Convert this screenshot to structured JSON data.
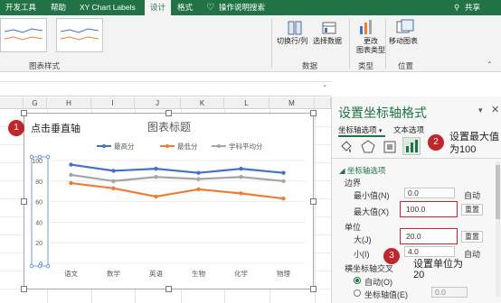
{
  "ribbon": {
    "tabs": [
      "开发工具",
      "帮助",
      "XY Chart Labels",
      "设计",
      "格式"
    ],
    "tell_me": "操作说明搜索",
    "share": "共享",
    "groups": {
      "chart_styles": "图表样式",
      "data": "数据",
      "type": "类型",
      "location": "位置"
    },
    "buttons": {
      "switch_row_col": "切换行/列",
      "select_data": "选择数据",
      "change_type": "更改\n图表类型",
      "move_chart": "移动图表"
    }
  },
  "columns": [
    "G",
    "H",
    "I",
    "J",
    "K",
    "L",
    "M"
  ],
  "chart": {
    "title": "图表标题",
    "legend": [
      "最高分",
      "最低分",
      "学科平均分"
    ],
    "categories": [
      "语文",
      "数学",
      "英语",
      "生物",
      "化学",
      "物理"
    ],
    "y_ticks": [
      "100",
      "80",
      "60",
      "40",
      "20",
      "0"
    ]
  },
  "chart_data": {
    "type": "line",
    "title": "图表标题",
    "categories": [
      "语文",
      "数学",
      "英语",
      "生物",
      "化学",
      "物理"
    ],
    "ylim": [
      0,
      100
    ],
    "y_major_unit": 20,
    "legend_position": "top",
    "series": [
      {
        "name": "最高分",
        "color": "#4472C4",
        "values": [
          96,
          90,
          92,
          88,
          92,
          88
        ]
      },
      {
        "name": "最低分",
        "color": "#ED7D31",
        "values": [
          78,
          73,
          65,
          72,
          68,
          63
        ]
      },
      {
        "name": "学科平均分",
        "color": "#A5A5A5",
        "values": [
          86,
          80,
          84,
          82,
          84,
          80
        ]
      }
    ]
  },
  "pane": {
    "title": "设置坐标轴格式",
    "tab_axis": "坐标轴选项",
    "tab_text": "文本选项",
    "section": "坐标轴选项",
    "bounds": "边界",
    "min_label": "最小值(N)",
    "min_value": "0.0",
    "max_label": "最大值(X)",
    "max_value": "100.0",
    "auto": "自动",
    "reset": "重置",
    "units": "单位",
    "major_label": "大(J)",
    "major_value": "20.0",
    "minor_label": "小(I)",
    "minor_value": "4.0",
    "cross_label": "横坐标轴交叉",
    "cross_auto": "自动(O)",
    "cross_value_label": "坐标轴值(E)",
    "cross_value": "0.0"
  },
  "annotations": {
    "a1": "点击垂直轴",
    "a2": "设置最大值\n为100",
    "a3": "设置单位为\n20",
    "n1": "1",
    "n2": "2",
    "n3": "3"
  },
  "colors": {
    "excel_green": "#217346",
    "annotation_red": "#C0272D"
  }
}
